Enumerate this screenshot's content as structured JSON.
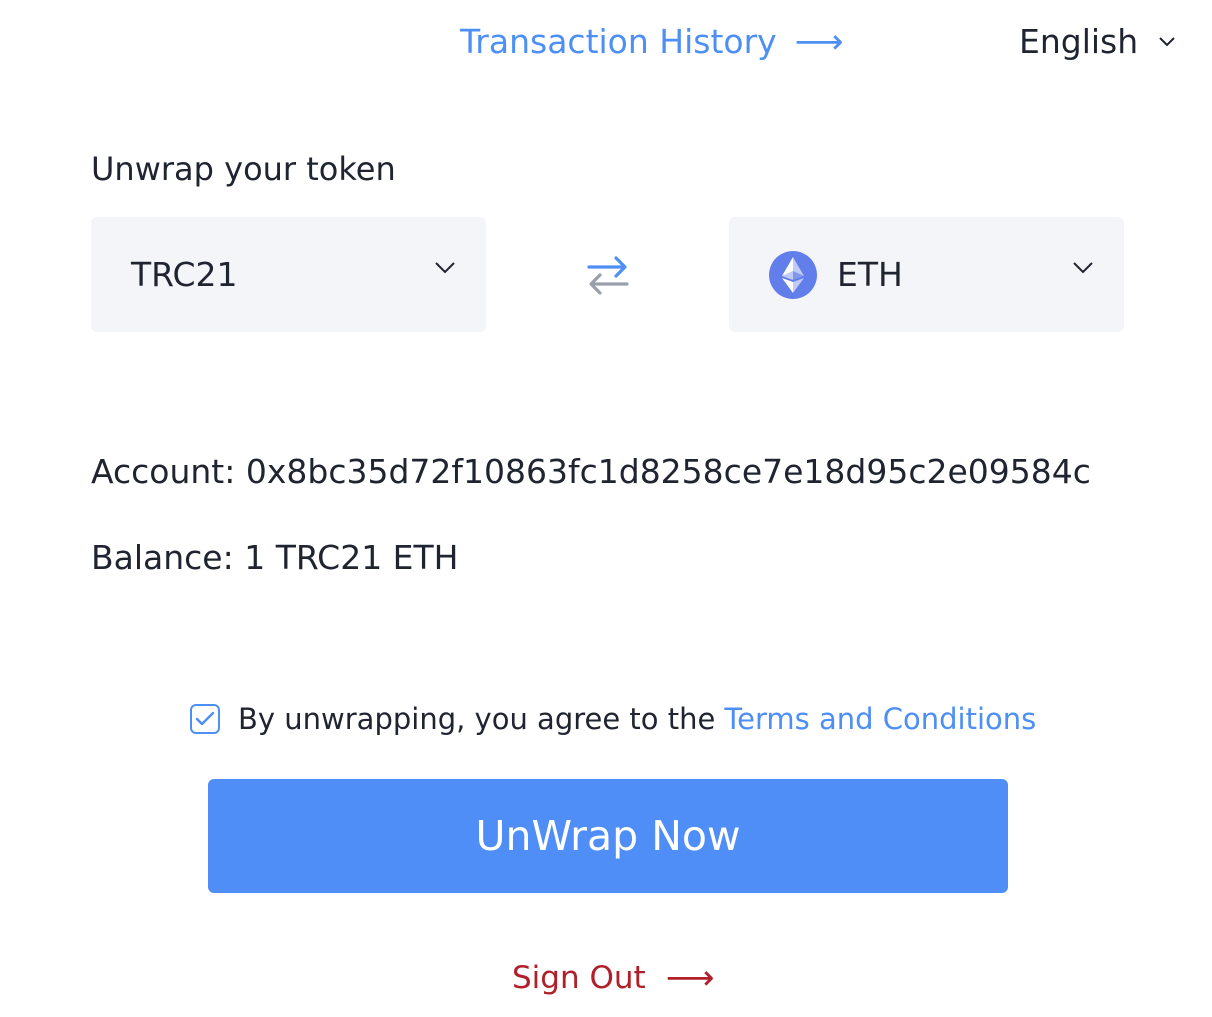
{
  "header": {
    "history_label": "Transaction History",
    "history_arrow": "⟶",
    "language": "English"
  },
  "form": {
    "title": "Unwrap your token",
    "from_token": "TRC21",
    "to_token": "ETH"
  },
  "account": {
    "account_text": "Account: 0x8bc35d72f10863fc1d8258ce7e18d95c2e09584c",
    "balance_text": "Balance: 1 TRC21 ETH"
  },
  "agreement": {
    "text": "By unwrapping, you agree to the",
    "terms_link": "Terms and Conditions",
    "checked": true
  },
  "actions": {
    "unwrap_label": "UnWrap Now",
    "signout_label": "Sign Out",
    "signout_arrow": "⟶"
  },
  "colors": {
    "accent": "#4f8ef7",
    "danger": "#b0202a",
    "select_bg": "#f4f5f9"
  },
  "icons": {
    "history_arrow": "arrow-right-icon",
    "language_chevron": "chevron-down-icon",
    "select_chevron": "chevron-down-icon",
    "swap": "swap-arrows-icon",
    "token": "ethereum-icon",
    "checkbox": "checkmark-icon",
    "signout_arrow": "arrow-right-icon"
  }
}
